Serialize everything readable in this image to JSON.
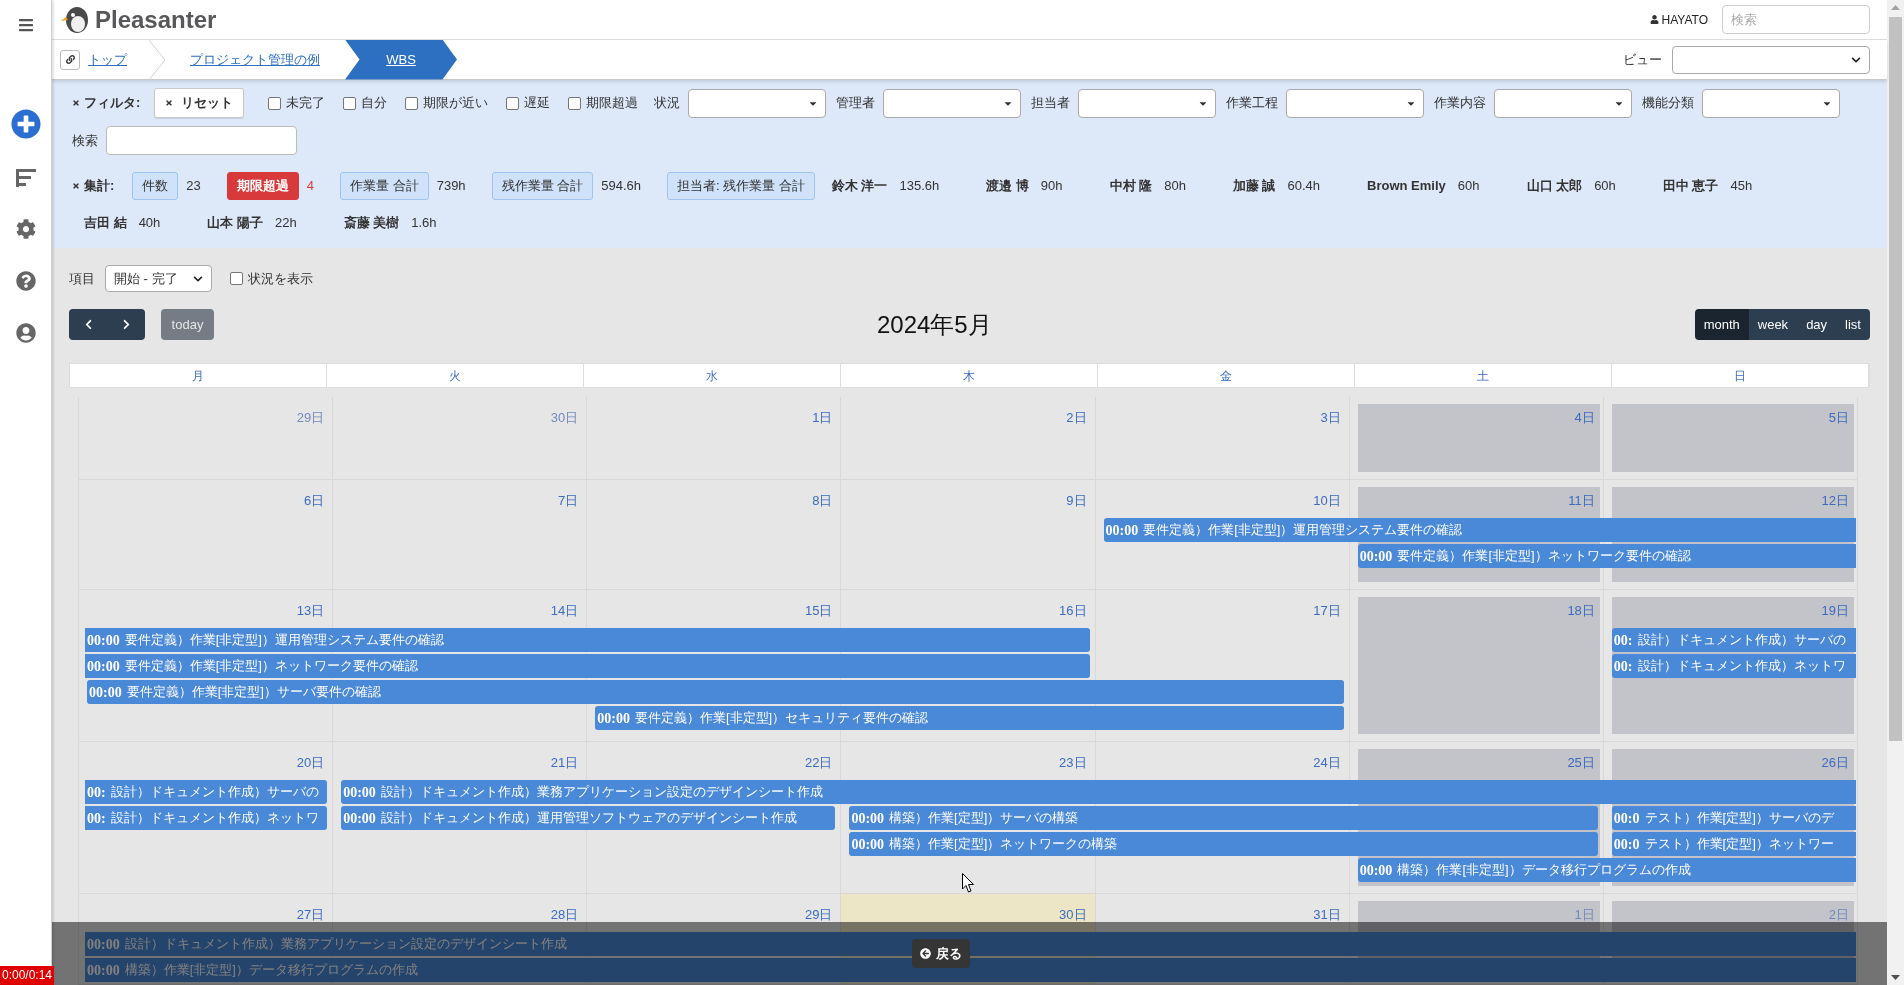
{
  "header": {
    "logo": "Pleasanter",
    "user": "HAYATO",
    "search": {
      "placeholder": "検索"
    }
  },
  "breadcrumb": {
    "items": [
      {
        "label": "トップ",
        "selected": false
      },
      {
        "label": "プロジェクト管理の例",
        "selected": false
      },
      {
        "label": "WBS",
        "selected": true
      }
    ],
    "view_label": "ビュー"
  },
  "filters": {
    "title": "フィルタ:",
    "reset": "リセット",
    "checkboxes": [
      {
        "label": "未完了",
        "checked": false
      },
      {
        "label": "自分",
        "checked": false
      },
      {
        "label": "期限が近い",
        "checked": false
      },
      {
        "label": "遅延",
        "checked": false
      },
      {
        "label": "期限超過",
        "checked": false
      }
    ],
    "selects": [
      {
        "label": "状況"
      },
      {
        "label": "管理者"
      },
      {
        "label": "担当者"
      },
      {
        "label": "作業工程"
      },
      {
        "label": "作業内容"
      },
      {
        "label": "機能分類"
      }
    ],
    "search_label": "検索"
  },
  "summary": {
    "title": "集計:",
    "items": [
      {
        "kind": "info",
        "label": "件数",
        "value": "23"
      },
      {
        "kind": "alert",
        "label": "期限超過",
        "value": "4"
      },
      {
        "kind": "info",
        "label": "作業量 合計",
        "value": "739h"
      },
      {
        "kind": "info",
        "label": "残作業量 合計",
        "value": "594.6h"
      }
    ],
    "assignee_label": "担当者: 残作業量 合計",
    "assignees": [
      {
        "name": "鈴木 洋一",
        "hours": "135.6h"
      },
      {
        "name": "渡邉 博",
        "hours": "90h"
      },
      {
        "name": "中村 隆",
        "hours": "80h"
      },
      {
        "name": "加藤 誠",
        "hours": "60.4h"
      },
      {
        "name": "Brown Emily",
        "hours": "60h"
      },
      {
        "name": "山口 太郎",
        "hours": "60h"
      },
      {
        "name": "田中 恵子",
        "hours": "45h"
      },
      {
        "name": "吉田 結",
        "hours": "40h"
      },
      {
        "name": "山本 陽子",
        "hours": "22h"
      },
      {
        "name": "斎藤 美樹",
        "hours": "1.6h"
      }
    ]
  },
  "calendar": {
    "item_select": {
      "label": "項目",
      "value": "開始 - 完了"
    },
    "show_status": {
      "label": "状況を表示",
      "checked": false
    },
    "today": {
      "label": "today",
      "disabled": true
    },
    "title": "2024年5月",
    "views": [
      {
        "label": "month",
        "selected": true
      },
      {
        "label": "week",
        "selected": false
      },
      {
        "label": "day",
        "selected": false
      },
      {
        "label": "list",
        "selected": false
      }
    ],
    "weekdays": [
      "月",
      "火",
      "水",
      "木",
      "金",
      "土",
      "日"
    ],
    "weeks": [
      {
        "days": [
          {
            "date": "29日",
            "other_month": true,
            "weekend": false,
            "today": false
          },
          {
            "date": "30日",
            "other_month": true,
            "weekend": false,
            "today": false
          },
          {
            "date": "1日",
            "other_month": false,
            "weekend": false,
            "today": false
          },
          {
            "date": "2日",
            "other_month": false,
            "weekend": false,
            "today": false
          },
          {
            "date": "3日",
            "other_month": false,
            "weekend": false,
            "today": false
          },
          {
            "date": "4日",
            "other_month": false,
            "weekend": true,
            "today": false
          },
          {
            "date": "5日",
            "other_month": false,
            "weekend": true,
            "today": false
          }
        ]
      },
      {
        "days": [
          {
            "date": "6日",
            "other_month": false,
            "weekend": false,
            "today": false
          },
          {
            "date": "7日",
            "other_month": false,
            "weekend": false,
            "today": false
          },
          {
            "date": "8日",
            "other_month": false,
            "weekend": false,
            "today": false
          },
          {
            "date": "9日",
            "other_month": false,
            "weekend": false,
            "today": false
          },
          {
            "date": "10日",
            "other_month": false,
            "weekend": false,
            "today": false
          },
          {
            "date": "11日",
            "other_month": false,
            "weekend": true,
            "today": false
          },
          {
            "date": "12日",
            "other_month": false,
            "weekend": true,
            "today": false
          }
        ],
        "lanes": [
          {
            "slots": [
              {
                "kind": "empty"
              },
              {
                "kind": "empty"
              },
              {
                "kind": "empty"
              },
              {
                "kind": "empty"
              },
              {
                "kind": "event",
                "time": "00:00",
                "title": "要件定義）作業[非定型]）運用管理システム要件の確認",
                "continues_before": false,
                "continues_after": true
              },
              {
                "kind": "span"
              },
              {
                "kind": "span"
              }
            ]
          },
          {
            "slots": [
              {
                "kind": "empty"
              },
              {
                "kind": "empty"
              },
              {
                "kind": "empty"
              },
              {
                "kind": "empty"
              },
              {
                "kind": "empty"
              },
              {
                "kind": "event",
                "time": "00:00",
                "title": "要件定義）作業[非定型]）ネットワーク要件の確認",
                "continues_before": false,
                "continues_after": true
              },
              {
                "kind": "span"
              }
            ]
          }
        ]
      },
      {
        "days": [
          {
            "date": "13日",
            "other_month": false,
            "weekend": false,
            "today": false
          },
          {
            "date": "14日",
            "other_month": false,
            "weekend": false,
            "today": false
          },
          {
            "date": "15日",
            "other_month": false,
            "weekend": false,
            "today": false
          },
          {
            "date": "16日",
            "other_month": false,
            "weekend": false,
            "today": false
          },
          {
            "date": "17日",
            "other_month": false,
            "weekend": false,
            "today": false
          },
          {
            "date": "18日",
            "other_month": false,
            "weekend": true,
            "today": false
          },
          {
            "date": "19日",
            "other_month": false,
            "weekend": true,
            "today": false
          }
        ],
        "lanes": [
          {
            "slots": [
              {
                "kind": "event",
                "time": "00:00",
                "title": "要件定義）作業[非定型]）運用管理システム要件の確認",
                "continues_before": true,
                "continues_after": false
              },
              {
                "kind": "span"
              },
              {
                "kind": "span"
              },
              {
                "kind": "span"
              },
              {
                "kind": "empty"
              },
              {
                "kind": "empty"
              },
              {
                "kind": "event",
                "time": "00:",
                "title": "設計）ドキュメント作成）サーバの",
                "continues_before": false,
                "continues_after": true
              }
            ]
          },
          {
            "slots": [
              {
                "kind": "event",
                "time": "00:00",
                "title": "要件定義）作業[非定型]）ネットワーク要件の確認",
                "continues_before": true,
                "continues_after": false
              },
              {
                "kind": "span"
              },
              {
                "kind": "span"
              },
              {
                "kind": "span"
              },
              {
                "kind": "empty"
              },
              {
                "kind": "empty"
              },
              {
                "kind": "event",
                "time": "00:",
                "title": "設計）ドキュメント作成）ネットワ",
                "continues_before": false,
                "continues_after": true
              }
            ]
          },
          {
            "slots": [
              {
                "kind": "event",
                "time": "00:00",
                "title": "要件定義）作業[非定型]）サーバ要件の確認",
                "continues_before": false,
                "continues_after": false
              },
              {
                "kind": "span"
              },
              {
                "kind": "span"
              },
              {
                "kind": "span"
              },
              {
                "kind": "span"
              },
              {
                "kind": "empty"
              },
              {
                "kind": "empty"
              }
            ]
          },
          {
            "slots": [
              {
                "kind": "empty"
              },
              {
                "kind": "empty"
              },
              {
                "kind": "event",
                "time": "00:00",
                "title": "要件定義）作業[非定型]）セキュリティ要件の確認",
                "continues_before": false,
                "continues_after": false
              },
              {
                "kind": "span"
              },
              {
                "kind": "span"
              },
              {
                "kind": "empty"
              },
              {
                "kind": "empty"
              }
            ]
          }
        ]
      },
      {
        "days": [
          {
            "date": "20日",
            "other_month": false,
            "weekend": false,
            "today": false
          },
          {
            "date": "21日",
            "other_month": false,
            "weekend": false,
            "today": false
          },
          {
            "date": "22日",
            "other_month": false,
            "weekend": false,
            "today": false
          },
          {
            "date": "23日",
            "other_month": false,
            "weekend": false,
            "today": false
          },
          {
            "date": "24日",
            "other_month": false,
            "weekend": false,
            "today": false
          },
          {
            "date": "25日",
            "other_month": false,
            "weekend": true,
            "today": false
          },
          {
            "date": "26日",
            "other_month": false,
            "weekend": true,
            "today": false
          }
        ],
        "lanes": [
          {
            "slots": [
              {
                "kind": "event",
                "time": "00:",
                "title": "設計）ドキュメント作成）サーバの",
                "continues_before": true,
                "continues_after": false
              },
              {
                "kind": "event",
                "time": "00:00",
                "title": "設計）ドキュメント作成）業務アプリケーション設定のデザインシート作成",
                "continues_before": false,
                "continues_after": true
              },
              {
                "kind": "span"
              },
              {
                "kind": "span"
              },
              {
                "kind": "span"
              },
              {
                "kind": "span"
              },
              {
                "kind": "span"
              }
            ]
          },
          {
            "slots": [
              {
                "kind": "event",
                "time": "00:",
                "title": "設計）ドキュメント作成）ネットワ",
                "continues_before": true,
                "continues_after": false
              },
              {
                "kind": "event",
                "time": "00:00",
                "title": "設計）ドキュメント作成）運用管理ソフトウェアのデザインシート作成",
                "continues_before": false,
                "continues_after": false
              },
              {
                "kind": "span"
              },
              {
                "kind": "event",
                "time": "00:00",
                "title": "構築）作業[定型]）サーバの構築",
                "continues_before": false,
                "continues_after": false
              },
              {
                "kind": "span"
              },
              {
                "kind": "span"
              },
              {
                "kind": "event",
                "time": "00:0",
                "title": "テスト）作業[定型]）サーバのデ",
                "continues_before": false,
                "continues_after": true
              }
            ]
          },
          {
            "slots": [
              {
                "kind": "empty"
              },
              {
                "kind": "empty"
              },
              {
                "kind": "empty"
              },
              {
                "kind": "event",
                "time": "00:00",
                "title": "構築）作業[定型]）ネットワークの構築",
                "continues_before": false,
                "continues_after": false
              },
              {
                "kind": "span"
              },
              {
                "kind": "span"
              },
              {
                "kind": "event",
                "time": "00:0",
                "title": "テスト）作業[定型]）ネットワー",
                "continues_before": false,
                "continues_after": true
              }
            ]
          },
          {
            "slots": [
              {
                "kind": "empty"
              },
              {
                "kind": "empty"
              },
              {
                "kind": "empty"
              },
              {
                "kind": "empty"
              },
              {
                "kind": "empty"
              },
              {
                "kind": "event",
                "time": "00:00",
                "title": "構築）作業[非定型]）データ移行プログラムの作成",
                "continues_before": false,
                "continues_after": true
              },
              {
                "kind": "span"
              }
            ]
          }
        ]
      },
      {
        "days": [
          {
            "date": "27日",
            "other_month": false,
            "weekend": false,
            "today": false
          },
          {
            "date": "28日",
            "other_month": false,
            "weekend": false,
            "today": false
          },
          {
            "date": "29日",
            "other_month": false,
            "weekend": false,
            "today": false
          },
          {
            "date": "30日",
            "other_month": false,
            "weekend": false,
            "today": true
          },
          {
            "date": "31日",
            "other_month": false,
            "weekend": false,
            "today": false
          },
          {
            "date": "1日",
            "other_month": true,
            "weekend": true,
            "today": false
          },
          {
            "date": "2日",
            "other_month": true,
            "weekend": true,
            "today": false
          }
        ],
        "lanes": [
          {
            "slots": [
              {
                "kind": "event",
                "time": "00:00",
                "title": "設計）ドキュメント作成）業務アプリケーション設定のデザインシート作成",
                "continues_before": true,
                "continues_after": true
              },
              {
                "kind": "span"
              },
              {
                "kind": "span"
              },
              {
                "kind": "span"
              },
              {
                "kind": "span"
              },
              {
                "kind": "span"
              },
              {
                "kind": "span"
              }
            ]
          },
          {
            "slots": [
              {
                "kind": "event",
                "time": "00:00",
                "title": "構築）作業[非定型]）データ移行プログラムの作成",
                "continues_before": true,
                "continues_after": true
              },
              {
                "kind": "span"
              },
              {
                "kind": "span"
              },
              {
                "kind": "span"
              },
              {
                "kind": "span"
              },
              {
                "kind": "span"
              },
              {
                "kind": "span"
              }
            ]
          }
        ]
      }
    ]
  },
  "overlay": {
    "back": "戻る",
    "timestamp": "0:00/0:14"
  }
}
